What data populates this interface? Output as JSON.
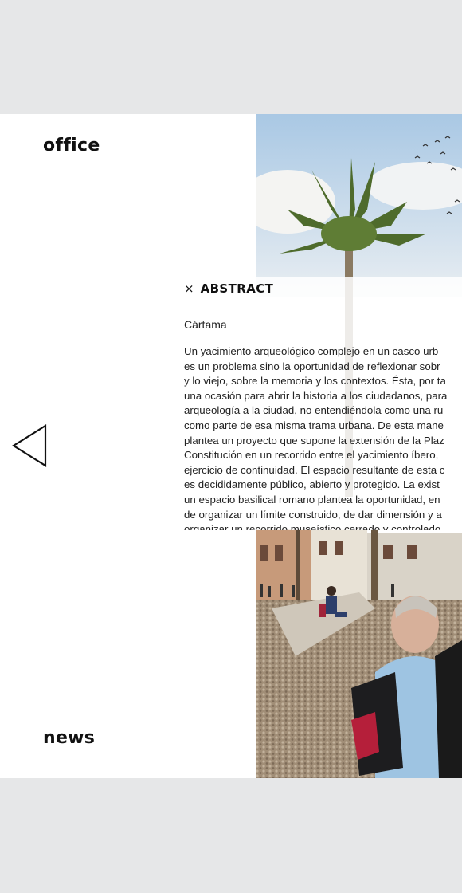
{
  "nav": {
    "office_label": "office",
    "news_label": "news"
  },
  "arrow": {
    "icon": "triangle-left-icon"
  },
  "abstract": {
    "close_icon": "×",
    "title": "ABSTRACT",
    "subtitle": "Cártama",
    "lines": [
      "Un yacimiento arqueológico complejo en un casco urb",
      "es un problema sino la oportunidad de reflexionar sobr",
      "y lo viejo, sobre la memoria y los contextos. Ésta, por ta",
      "una ocasión para abrir la historia a los ciudadanos, para",
      "arqueología a la ciudad, no entendiéndola como una ru",
      "como parte de esa misma trama urbana. De esta mane",
      "plantea un proyecto que supone la extensión de la Plaz",
      "Constitución en un recorrido entre el yacimiento íbero,",
      "ejercicio de continuidad. El espacio resultante de esta c",
      "es decididamente público, abierto y protegido. La exist",
      "un espacio basilical romano plantea la oportunidad, en",
      "de organizar un límite construido, de dar dimensión y a",
      "organizar un recorrido museístico cerrado y controlado"
    ]
  },
  "colors": {
    "background": "#e6e7e8",
    "panel": "#ffffff",
    "text": "#111111"
  }
}
